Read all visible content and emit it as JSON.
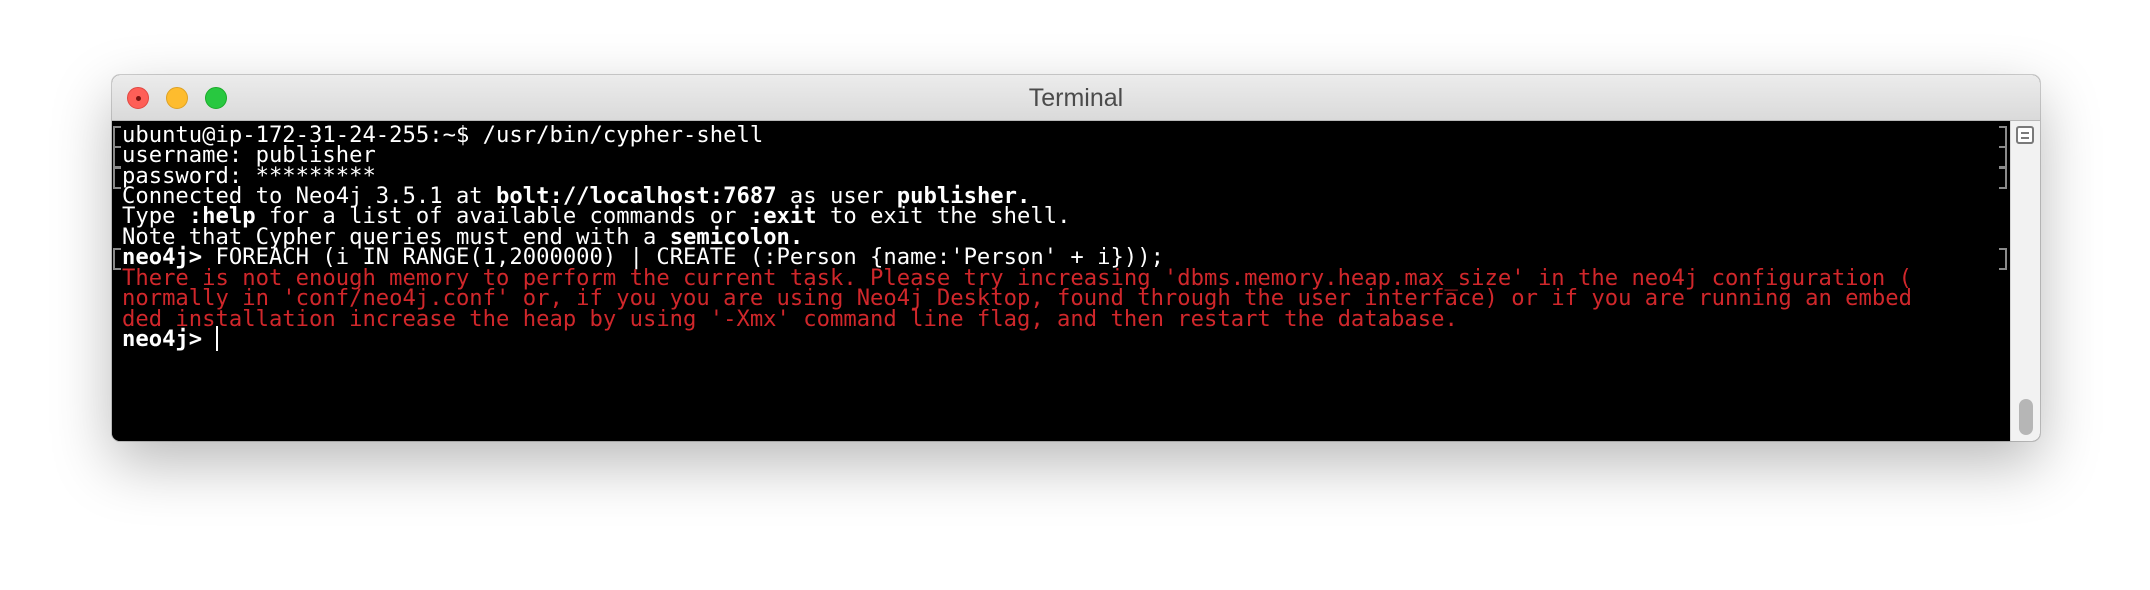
{
  "window": {
    "title": "Terminal"
  },
  "terminal": {
    "l1": "ubuntu@ip-172-31-24-255:~$ /usr/bin/cypher-shell",
    "l2": "username: publisher",
    "l3": "password: *********",
    "l4a": "Connected to Neo4j 3.5.1 at ",
    "l4b": "bolt://localhost:7687",
    "l4c": " as user ",
    "l4d": "publisher",
    "l4e": ".",
    "l5a": "Type ",
    "l5b": ":help",
    "l5c": " for a list of available commands or ",
    "l5d": ":exit",
    "l5e": " to exit the shell.",
    "l6a": "Note that Cypher queries must end with a ",
    "l6b": "semicolon.",
    "l7a": "neo4j> ",
    "l7b": "FOREACH (i IN RANGE(1,2000000) | CREATE (:Person {name:'Person' + i}));",
    "err1": "There is not enough memory to perform the current task. Please try increasing 'dbms.memory.heap.max_size' in the neo4j configuration (",
    "err2": "normally in 'conf/neo4j.conf' or, if you you are using Neo4j Desktop, found through the user interface) or if you are running an embed",
    "err3": "ded installation increase the heap by using '-Xmx' command line flag, and then restart the database.",
    "prompt": "neo4j> "
  },
  "colors": {
    "background": "#000000",
    "text": "#ffffff",
    "error": "#d0272b"
  },
  "icons": {
    "close": "close-traffic-light-icon",
    "minimize": "minimize-traffic-light-icon",
    "zoom": "zoom-traffic-light-icon",
    "scrollbar_button": "list-icon"
  }
}
